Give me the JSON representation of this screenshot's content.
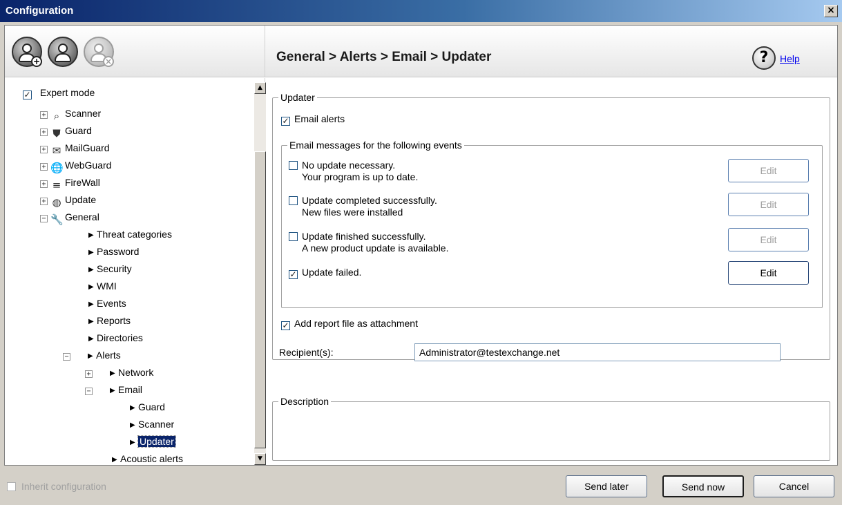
{
  "window": {
    "title": "Configuration",
    "close_glyph": "×"
  },
  "toolbar": {
    "icons": [
      "profile-add-icon",
      "profile-edit-icon",
      "profile-remove-icon"
    ],
    "breadcrumb": "General > Alerts > Email > Updater",
    "help_glyph": "?",
    "help_label": "Help"
  },
  "tree": {
    "expert_mode": {
      "label": "Expert mode",
      "checked": true
    },
    "items": [
      {
        "label": "Scanner",
        "icon": "magnifier-icon"
      },
      {
        "label": "Guard",
        "icon": "shield-icon"
      },
      {
        "label": "MailGuard",
        "icon": "mail-icon"
      },
      {
        "label": "WebGuard",
        "icon": "globe-icon"
      },
      {
        "label": "FireWall",
        "icon": "firewall-icon"
      },
      {
        "label": "Update",
        "icon": "update-globe-icon"
      },
      {
        "label": "General",
        "icon": "wrench-icon"
      },
      {
        "label": "Threat categories"
      },
      {
        "label": "Password"
      },
      {
        "label": "Security"
      },
      {
        "label": "WMI"
      },
      {
        "label": "Events"
      },
      {
        "label": "Reports"
      },
      {
        "label": "Directories"
      },
      {
        "label": "Alerts"
      },
      {
        "label": "Network"
      },
      {
        "label": "Email"
      },
      {
        "label": "Guard"
      },
      {
        "label": "Scanner"
      },
      {
        "label": "Updater",
        "selected": true
      },
      {
        "label": "Acoustic alerts"
      }
    ]
  },
  "updater": {
    "group_label": "Updater",
    "email_alerts_label": "Email alerts",
    "events_group_label": "Email messages for the following events",
    "events": [
      {
        "line1": "No update necessary.",
        "line2": "Your program is up to date.",
        "checked": false,
        "edit_label": "Edit",
        "edit_enabled": false
      },
      {
        "line1": "Update completed successfully.",
        "line2": "New files were installed",
        "checked": false,
        "edit_label": "Edit",
        "edit_enabled": false
      },
      {
        "line1": "Update finished successfully.",
        "line2": "A new product update is available.",
        "checked": false,
        "edit_label": "Edit",
        "edit_enabled": false
      },
      {
        "line1": "Update failed.",
        "line2": "",
        "checked": true,
        "edit_label": "Edit",
        "edit_enabled": true
      }
    ],
    "attachment_label": "Add report file as attachment",
    "recipients_label": "Recipient(s):",
    "recipients_value": "Administrator@testexchange.net"
  },
  "description": {
    "group_label": "Description"
  },
  "footer": {
    "inherit_label": "Inherit configuration",
    "send_later": "Send later",
    "send_now": "Send now",
    "cancel": "Cancel"
  },
  "check_glyph": "✓"
}
